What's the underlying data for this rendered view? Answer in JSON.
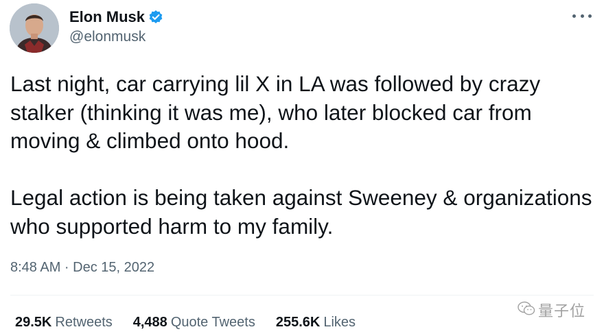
{
  "author": {
    "display_name": "Elon Musk",
    "handle": "@elonmusk",
    "avatar_icon": "avatar-photo",
    "verified_icon": "verified-badge-icon",
    "verified_color": "#1d9bf0"
  },
  "tweet": {
    "paragraphs": [
      "Last night, car carrying lil X in LA was followed by crazy stalker (thinking it was me), who later blocked car from moving & climbed onto hood.",
      "Legal action is being taken against Sweeney & organizations who supported harm to my family."
    ],
    "timestamp": "8:48 AM · Dec 15, 2022"
  },
  "stats": [
    {
      "value": "29.5K",
      "label": "Retweets"
    },
    {
      "value": "4,488",
      "label": "Quote Tweets"
    },
    {
      "value": "255.6K",
      "label": "Likes"
    }
  ],
  "menu_icon": "more-horizontal-icon",
  "watermark": {
    "text": "量子位",
    "icon": "wechat-icon"
  }
}
